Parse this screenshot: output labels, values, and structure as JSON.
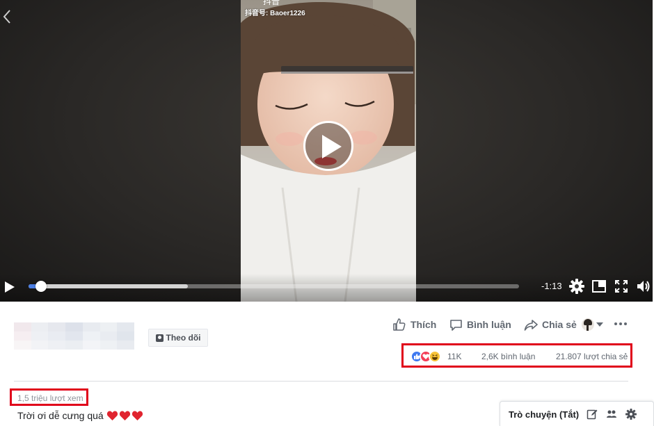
{
  "video": {
    "watermark": "抖音号: Baoer1226",
    "logo_text": "抖音",
    "time_remaining": "-1:13",
    "progress_fraction": 0.026,
    "buffered_fraction": 0.325
  },
  "post": {
    "follow_label": "Theo dõi",
    "actions": {
      "like_label": "Thích",
      "comment_label": "Bình luận",
      "share_label": "Chia sẻ"
    },
    "stats": {
      "reactions_count": "11K",
      "comments": "2,6K bình luận",
      "shares": "21.807 lượt chia sẻ"
    },
    "views": "1,5 triệu lượt xem",
    "caption": "Trời ơi dễ cưng quá"
  },
  "chat": {
    "label": "Trò chuyện (Tắt)"
  },
  "colors": {
    "highlight_box": "#e0001a",
    "progress": "#4a7de2",
    "like": "#3f79f0",
    "love": "#f33e58",
    "haha": "#f7c338"
  },
  "icons": [
    "chevron-left-icon",
    "play-icon",
    "settings-gear-icon",
    "picture-in-picture-icon",
    "fullscreen-icon",
    "volume-icon",
    "thumbs-up-icon",
    "comment-bubble-icon",
    "share-arrow-icon",
    "chevron-down-icon",
    "more-dots-icon",
    "compose-icon",
    "group-chat-icon",
    "heart-icon"
  ]
}
